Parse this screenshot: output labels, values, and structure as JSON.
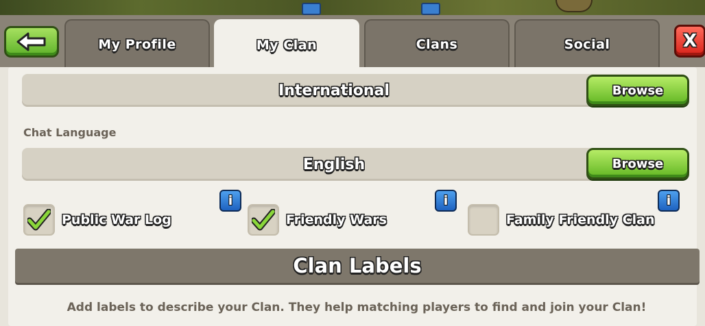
{
  "tabs": [
    {
      "label": "My Profile",
      "active": false
    },
    {
      "label": "My Clan",
      "active": true
    },
    {
      "label": "Clans",
      "active": false
    },
    {
      "label": "Social",
      "active": false
    }
  ],
  "close_label": "X",
  "location": {
    "value": "International",
    "browse_label": "Browse"
  },
  "chat_language": {
    "label": "Chat Language",
    "value": "English",
    "browse_label": "Browse"
  },
  "options": [
    {
      "label": "Public War Log",
      "checked": true
    },
    {
      "label": "Friendly Wars",
      "checked": true
    },
    {
      "label": "Family Friendly Clan",
      "checked": false
    }
  ],
  "info_label": "i",
  "clan_labels": {
    "title": "Clan Labels",
    "description": "Add labels to describe your Clan. They help matching players to find and join your Clan!"
  },
  "colors": {
    "button_green": "#62b623",
    "close_red": "#d9231a",
    "info_blue": "#1e62c0",
    "panel": "#f2f0ea",
    "tab_inactive": "#7b7469"
  }
}
